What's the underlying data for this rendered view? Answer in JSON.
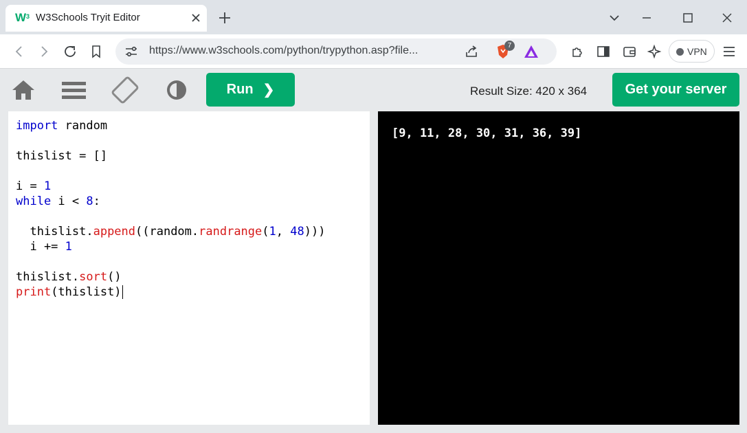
{
  "browser": {
    "tab_title": "W3Schools Tryit Editor",
    "favicon_text": "W",
    "favicon_sup": "3",
    "url": "https://www.w3schools.com/python/trypython.asp?file...",
    "brave_badge_count": "7",
    "vpn_label": "VPN",
    "accent_brave": "#e8532c",
    "accent_triangle": "#8a2be2"
  },
  "toolbar": {
    "icons": [
      "home-icon",
      "menu-icon",
      "rotate-icon",
      "contrast-icon"
    ],
    "run_label": "Run",
    "run_chevron": "❯",
    "result_size_label": "Result Size: 420 x 364",
    "server_label": "Get your server",
    "accent": "#04aa6d"
  },
  "editor": {
    "lines": [
      [
        {
          "t": "import",
          "c": "kw"
        },
        {
          "t": " random",
          "c": ""
        }
      ],
      [],
      [
        {
          "t": "thislist = []",
          "c": ""
        }
      ],
      [],
      [
        {
          "t": "i = ",
          "c": ""
        },
        {
          "t": "1",
          "c": "num"
        }
      ],
      [
        {
          "t": "while",
          "c": "kw"
        },
        {
          "t": " i < ",
          "c": ""
        },
        {
          "t": "8",
          "c": "num"
        },
        {
          "t": ":",
          "c": ""
        }
      ],
      [],
      [
        {
          "t": "  thislist.",
          "c": ""
        },
        {
          "t": "append",
          "c": "fn"
        },
        {
          "t": "((random.",
          "c": ""
        },
        {
          "t": "randrange",
          "c": "fn"
        },
        {
          "t": "(",
          "c": ""
        },
        {
          "t": "1",
          "c": "num"
        },
        {
          "t": ", ",
          "c": ""
        },
        {
          "t": "48",
          "c": "num"
        },
        {
          "t": ")))",
          "c": ""
        }
      ],
      [
        {
          "t": "  i += ",
          "c": ""
        },
        {
          "t": "1",
          "c": "num"
        }
      ],
      [],
      [
        {
          "t": "thislist.",
          "c": ""
        },
        {
          "t": "sort",
          "c": "fn"
        },
        {
          "t": "()",
          "c": ""
        }
      ],
      [
        {
          "t": "print",
          "c": "fn"
        },
        {
          "t": "(thislist)",
          "c": ""
        }
      ]
    ]
  },
  "output": {
    "text": "[9, 11, 28, 30, 31, 36, 39]"
  }
}
